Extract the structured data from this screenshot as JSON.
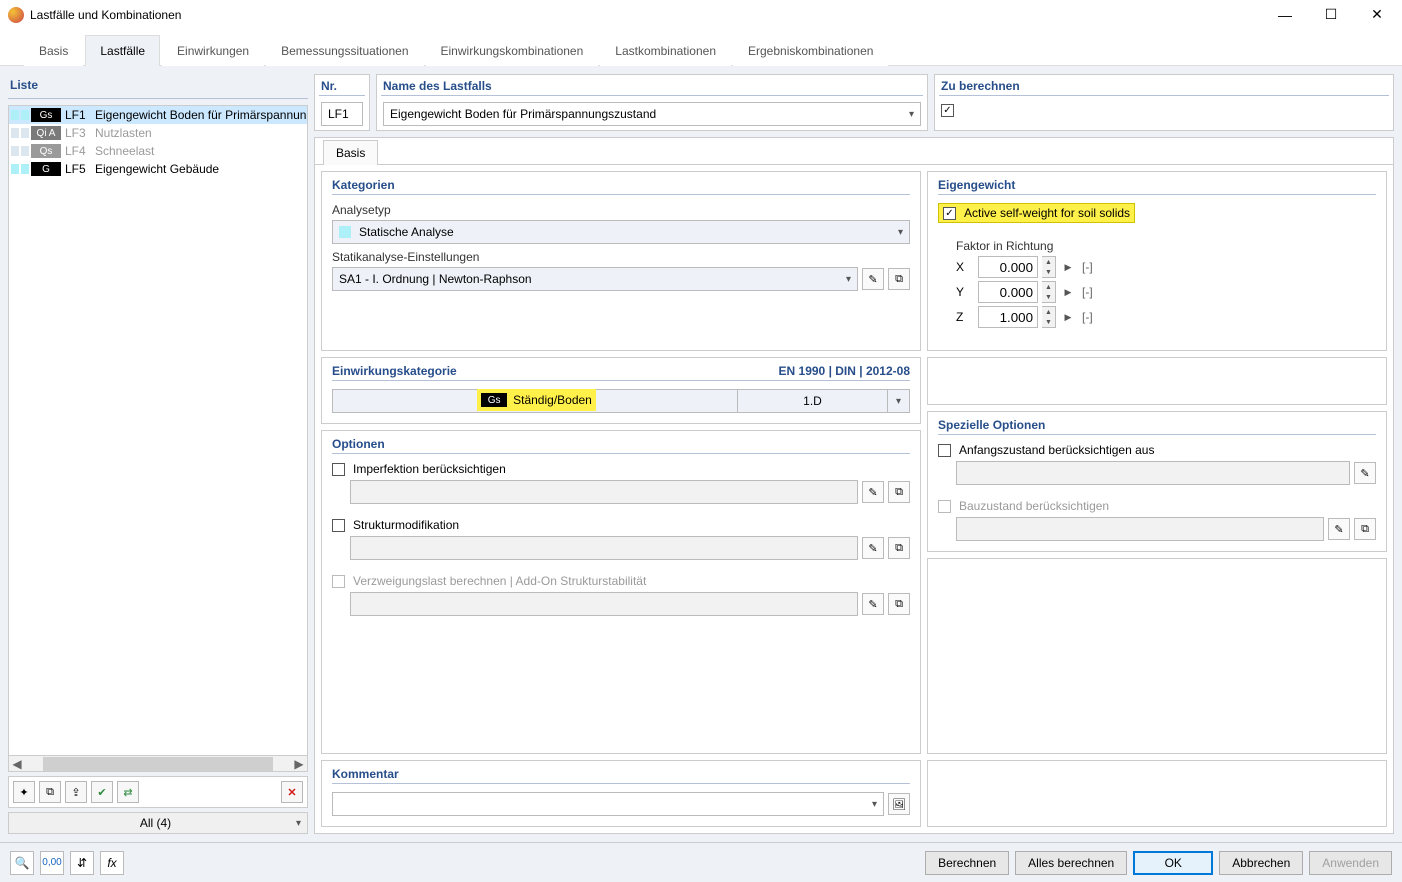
{
  "window": {
    "title": "Lastfälle und Kombinationen"
  },
  "winbuttons": {
    "min": "—",
    "max": "☐",
    "close": "✕"
  },
  "tabs": [
    "Basis",
    "Lastfälle",
    "Einwirkungen",
    "Bemessungssituationen",
    "Einwirkungskombinationen",
    "Lastkombinationen",
    "Ergebniskombinationen"
  ],
  "activeTab": 1,
  "list": {
    "title": "Liste",
    "rows": [
      {
        "tag": "Gs",
        "lf": "LF1",
        "text": "Eigengewicht Boden für Primärspannun",
        "selected": true,
        "disabled": false,
        "tagclass": "gs",
        "sw": "c1"
      },
      {
        "tag": "Qi A",
        "lf": "LF3",
        "text": "Nutzlasten",
        "selected": false,
        "disabled": true,
        "tagclass": "qia",
        "sw": "c2"
      },
      {
        "tag": "Qs",
        "lf": "LF4",
        "text": "Schneelast",
        "selected": false,
        "disabled": true,
        "tagclass": "qs",
        "sw": "c3"
      },
      {
        "tag": "G",
        "lf": "LF5",
        "text": "Eigengewicht Gebäude",
        "selected": false,
        "disabled": false,
        "tagclass": "g",
        "sw": "c1"
      }
    ],
    "filter": "All (4)"
  },
  "top": {
    "nr_label": "Nr.",
    "nr_value": "LF1",
    "name_label": "Name des Lastfalls",
    "name_value": "Eigengewicht Boden für Primärspannungszustand",
    "calc_label": "Zu berechnen"
  },
  "innertab": "Basis",
  "kategorien": {
    "title": "Kategorien",
    "analysetyp_label": "Analysetyp",
    "analysetyp_value": "Statische Analyse",
    "statik_label": "Statikanalyse-Einstellungen",
    "statik_value": "SA1 - I. Ordnung | Newton-Raphson"
  },
  "einwkat": {
    "title": "Einwirkungskategorie",
    "standard": "EN 1990 | DIN | 2012-08",
    "tag": "Gs",
    "text": "Ständig/Boden",
    "code": "1.D"
  },
  "optionen": {
    "title": "Optionen",
    "imperf": "Imperfektion berücksichtigen",
    "struct": "Strukturmodifikation",
    "verzw": "Verzweigungslast berechnen | Add-On Strukturstabilität"
  },
  "eigengewicht": {
    "title": "Eigengewicht",
    "active": "Active self-weight for soil solids",
    "faktor_label": "Faktor in Richtung",
    "rows": [
      {
        "axis": "X",
        "val": "0.000",
        "unit": "[-]"
      },
      {
        "axis": "Y",
        "val": "0.000",
        "unit": "[-]"
      },
      {
        "axis": "Z",
        "val": "1.000",
        "unit": "[-]"
      }
    ]
  },
  "spezielle": {
    "title": "Spezielle Optionen",
    "anfang": "Anfangszustand berücksichtigen aus",
    "bau": "Bauzustand berücksichtigen"
  },
  "kommentar": {
    "title": "Kommentar"
  },
  "footer": {
    "berechnen": "Berechnen",
    "alles": "Alles berechnen",
    "ok": "OK",
    "abbrechen": "Abbrechen",
    "anwenden": "Anwenden"
  },
  "icons": {
    "new": "✦",
    "copy": "⧉",
    "import": "⇪",
    "check": "✔",
    "link": "⇄",
    "delete": "✕",
    "pick1": "✎",
    "pick2": "⧉",
    "search": "🔍",
    "num": "0,00",
    "unit": "⇵",
    "fx": "fx",
    "img": "🖼"
  }
}
